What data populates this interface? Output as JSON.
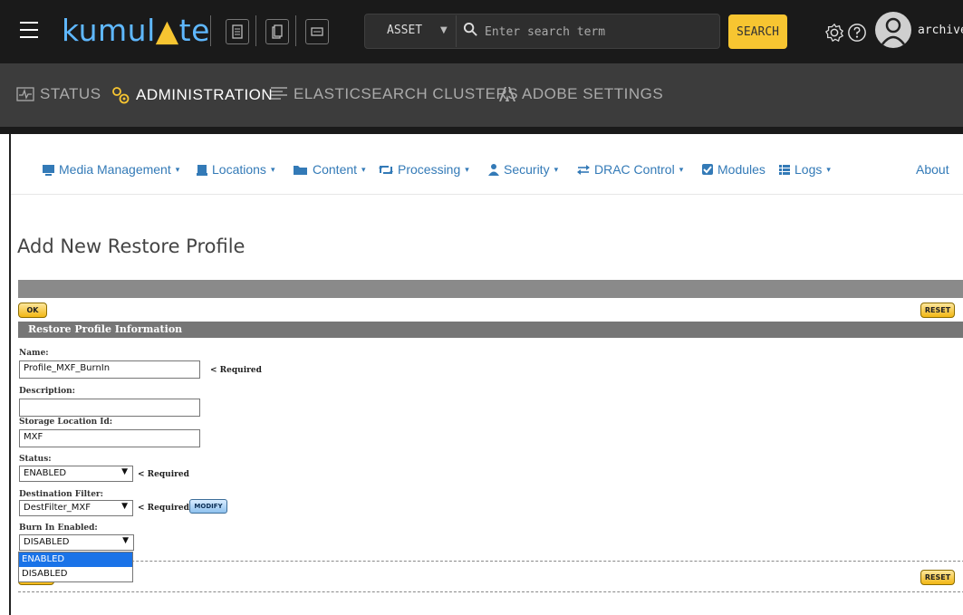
{
  "top": {
    "logo_text": "kumul",
    "logo_tri": "▲",
    "logo_end": "te",
    "search_scope": "ASSET",
    "search_placeholder": "Enter search term",
    "search_button": "SEARCH",
    "username": "archiver"
  },
  "nav2": {
    "items": [
      {
        "label": "STATUS",
        "icon": "pulse-icon"
      },
      {
        "label": "ADMINISTRATION",
        "icon": "gears-icon"
      },
      {
        "label": "ELASTICSEARCH CLUSTERS",
        "icon": "list-icon"
      },
      {
        "label": "ADOBE SETTINGS",
        "icon": "adobe-icon"
      }
    ]
  },
  "menu": {
    "items": [
      {
        "label": "Media Management",
        "caret": "▾"
      },
      {
        "label": "Locations",
        "caret": "▾"
      },
      {
        "label": "Content",
        "caret": "▾"
      },
      {
        "label": "Processing",
        "caret": "▾"
      },
      {
        "label": "Security",
        "caret": "▾"
      },
      {
        "label": "DRAC Control",
        "caret": "▾"
      },
      {
        "label": "Modules",
        "caret": ""
      },
      {
        "label": "Logs",
        "caret": "▾"
      },
      {
        "label": "About",
        "caret": ""
      }
    ]
  },
  "page": {
    "title": "Add New Restore Profile",
    "ok_label": "OK",
    "reset_label": "RESET",
    "section_title": "Restore Profile Information",
    "required_text": "< Required",
    "modify_label": "MODIFY"
  },
  "form": {
    "name_label": "Name:",
    "name_value": "Profile_MXF_BurnIn",
    "description_label": "Description:",
    "description_value": "",
    "storage_label": "Storage Location Id:",
    "storage_value": "MXF",
    "status_label": "Status:",
    "status_value": "ENABLED",
    "destination_label": "Destination Filter:",
    "destination_value": "DestFilter_MXF",
    "burnin_label": "Burn In Enabled:",
    "burnin_value": "DISABLED",
    "burnin_options": [
      "ENABLED",
      "DISABLED"
    ]
  },
  "colors": {
    "topbar": "#1a1a1a",
    "nav2": "#3c3c3c",
    "accent_yellow": "#f7c531",
    "link_blue": "#337ab7",
    "logo_blue": "#5fb8ff",
    "option_highlight": "#1a73e8"
  }
}
